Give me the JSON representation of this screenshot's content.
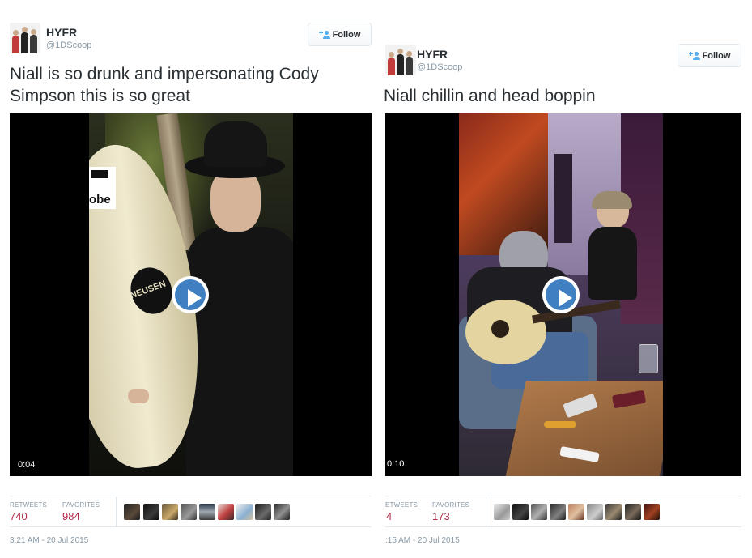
{
  "tweets": [
    {
      "user": {
        "name": "HYFR",
        "handle": "@1DScoop"
      },
      "follow_label": "Follow",
      "text_lines": [
        "Niall is so drunk and impersonating Cody",
        "Simpson this is so great"
      ],
      "video": {
        "duration": "0:04",
        "surfboard_text": "obe",
        "sticker_text": "NEUSEN"
      },
      "stats": {
        "retweets_label": "RETWEETS",
        "retweets": "740",
        "favorites_label": "FAVORITES",
        "favorites": "984"
      },
      "timestamp": "3:21 AM - 20 Jul 2015"
    },
    {
      "user": {
        "name": "HYFR",
        "handle": "@1DScoop"
      },
      "follow_label": "Follow",
      "text_lines": [
        "Niall chillin and head boppin"
      ],
      "video": {
        "duration": "0:10"
      },
      "stats": {
        "retweets_label": "ETWEETS",
        "retweets": "4",
        "favorites_label": "FAVORITES",
        "favorites": "173"
      },
      "timestamp": ":15 AM - 20 Jul 2015"
    }
  ],
  "icons": {
    "follow": "follow-user-icon",
    "play": "play-icon"
  },
  "colors": {
    "accent": "#55acee",
    "stat_value": "#b22b47",
    "play": "#3f7fc2",
    "muted": "#8899a6"
  }
}
